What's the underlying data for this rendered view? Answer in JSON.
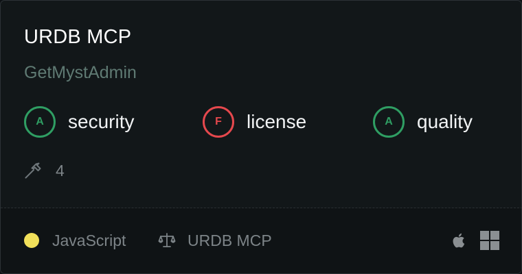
{
  "server": {
    "name": "URDB MCP",
    "author": "GetMystAdmin"
  },
  "scores": [
    {
      "grade": "A",
      "label": "security",
      "status": "pass"
    },
    {
      "grade": "F",
      "label": "license",
      "status": "fail"
    },
    {
      "grade": "A",
      "label": "quality",
      "status": "pass"
    }
  ],
  "tools": {
    "icon": "hammer-icon",
    "count": "4"
  },
  "footer": {
    "language": "JavaScript",
    "language_color": "#f1e05a",
    "license_icon": "scale-icon",
    "license": "URDB MCP",
    "platforms": [
      "apple-icon",
      "windows-icon"
    ]
  },
  "colors": {
    "pass": "#2f9e63",
    "fail": "#e5484d"
  }
}
